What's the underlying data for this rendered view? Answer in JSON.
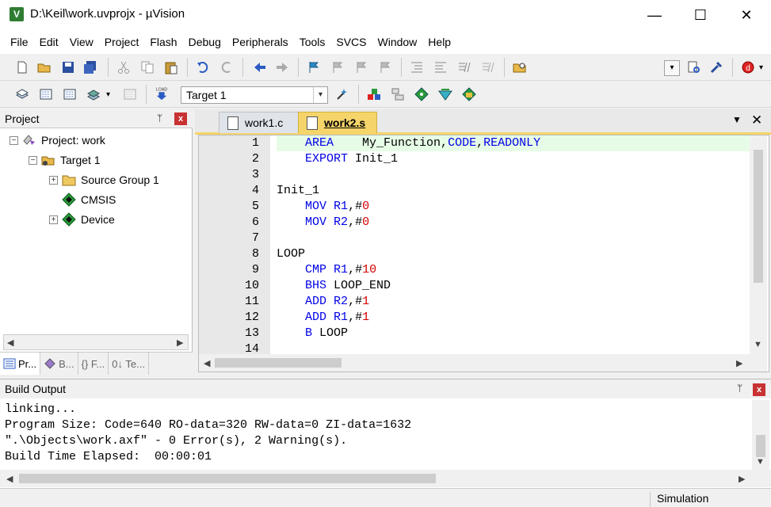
{
  "window": {
    "app_icon_letter": "V",
    "title": "D:\\Keil\\work.uvprojx - µVision",
    "minimize": "—",
    "maximize": "☐",
    "close": "✕"
  },
  "menu": [
    "File",
    "Edit",
    "View",
    "Project",
    "Flash",
    "Debug",
    "Peripherals",
    "Tools",
    "SVCS",
    "Window",
    "Help"
  ],
  "toolbar2": {
    "target_value": "Target 1",
    "load_label": "LOAD"
  },
  "project_panel": {
    "title": "Project",
    "pin": "ᛘ",
    "close": "x",
    "tree": [
      {
        "label": "Project: work",
        "expander": "−"
      },
      {
        "label": "Target 1",
        "expander": "−"
      },
      {
        "label": "Source Group 1",
        "expander": "+"
      },
      {
        "label": "CMSIS",
        "expander": ""
      },
      {
        "label": "Device",
        "expander": "+"
      }
    ],
    "tabs": [
      "Pr...",
      "B...",
      "{} F...",
      "0↓ Te..."
    ]
  },
  "editor": {
    "tabs": [
      {
        "label": "work1.c",
        "active": false
      },
      {
        "label": "work2.s",
        "active": true
      }
    ],
    "tab_menu": "▼",
    "tab_close": "✕",
    "lines": [
      {
        "n": "1",
        "parts": [
          {
            "t": "    ",
            "c": ""
          },
          {
            "t": "AREA",
            "c": "kw"
          },
          {
            "t": "    My_Function,",
            "c": ""
          },
          {
            "t": "CODE",
            "c": "kw"
          },
          {
            "t": ",",
            "c": ""
          },
          {
            "t": "READONLY",
            "c": "kw"
          }
        ],
        "highlight": true
      },
      {
        "n": "2",
        "parts": [
          {
            "t": "    ",
            "c": ""
          },
          {
            "t": "EXPORT",
            "c": "kw"
          },
          {
            "t": " Init_1",
            "c": ""
          }
        ]
      },
      {
        "n": "3",
        "parts": []
      },
      {
        "n": "4",
        "parts": [
          {
            "t": "Init_1",
            "c": ""
          }
        ]
      },
      {
        "n": "5",
        "parts": [
          {
            "t": "    ",
            "c": ""
          },
          {
            "t": "MOV",
            "c": "kw"
          },
          {
            "t": " ",
            "c": ""
          },
          {
            "t": "R1",
            "c": "kw"
          },
          {
            "t": ",#",
            "c": ""
          },
          {
            "t": "0",
            "c": "num"
          }
        ]
      },
      {
        "n": "6",
        "parts": [
          {
            "t": "    ",
            "c": ""
          },
          {
            "t": "MOV",
            "c": "kw"
          },
          {
            "t": " ",
            "c": ""
          },
          {
            "t": "R2",
            "c": "kw"
          },
          {
            "t": ",#",
            "c": ""
          },
          {
            "t": "0",
            "c": "num"
          }
        ]
      },
      {
        "n": "7",
        "parts": []
      },
      {
        "n": "8",
        "parts": [
          {
            "t": "LOOP",
            "c": ""
          }
        ]
      },
      {
        "n": "9",
        "parts": [
          {
            "t": "    ",
            "c": ""
          },
          {
            "t": "CMP",
            "c": "kw"
          },
          {
            "t": " ",
            "c": ""
          },
          {
            "t": "R1",
            "c": "kw"
          },
          {
            "t": ",#",
            "c": ""
          },
          {
            "t": "10",
            "c": "num"
          }
        ]
      },
      {
        "n": "10",
        "parts": [
          {
            "t": "    ",
            "c": ""
          },
          {
            "t": "BHS",
            "c": "kw"
          },
          {
            "t": " LOOP_END",
            "c": ""
          }
        ]
      },
      {
        "n": "11",
        "parts": [
          {
            "t": "    ",
            "c": ""
          },
          {
            "t": "ADD",
            "c": "kw"
          },
          {
            "t": " ",
            "c": ""
          },
          {
            "t": "R2",
            "c": "kw"
          },
          {
            "t": ",#",
            "c": ""
          },
          {
            "t": "1",
            "c": "num"
          }
        ]
      },
      {
        "n": "12",
        "parts": [
          {
            "t": "    ",
            "c": ""
          },
          {
            "t": "ADD",
            "c": "kw"
          },
          {
            "t": " ",
            "c": ""
          },
          {
            "t": "R1",
            "c": "kw"
          },
          {
            "t": ",#",
            "c": ""
          },
          {
            "t": "1",
            "c": "num"
          }
        ]
      },
      {
        "n": "13",
        "parts": [
          {
            "t": "    ",
            "c": ""
          },
          {
            "t": "B",
            "c": "kw"
          },
          {
            "t": " LOOP",
            "c": ""
          }
        ]
      },
      {
        "n": "14",
        "parts": []
      }
    ]
  },
  "build_output": {
    "title": "Build Output",
    "pin": "ᛘ",
    "close": "x",
    "lines": [
      "linking...",
      "Program Size: Code=640 RO-data=320 RW-data=0 ZI-data=1632",
      "\".\\Objects\\work.axf\" - 0 Error(s), 2 Warning(s).",
      "Build Time Elapsed:  00:00:01"
    ]
  },
  "statusbar": {
    "mode": "Simulation"
  },
  "colors": {
    "keyword": "#0000e6",
    "number": "#d00000",
    "active_tab": "#f5d46a",
    "current_line": "#e6fce6"
  }
}
